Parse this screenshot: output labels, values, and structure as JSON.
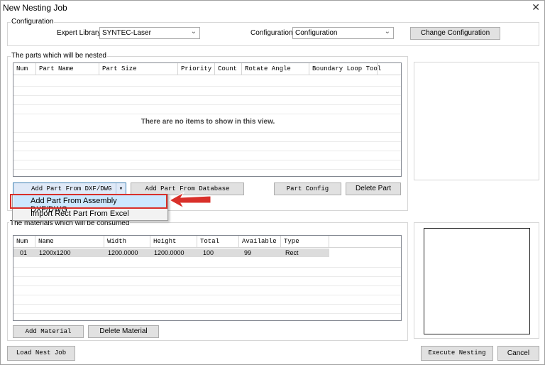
{
  "window": {
    "title": "New Nesting Job",
    "close_glyph": "✕"
  },
  "configuration": {
    "group_label": "Configuration",
    "expert_library_label": "Expert Library:",
    "expert_library_value": "SYNTEC-Laser",
    "configuration_label": "Configuration:",
    "configuration_value": "Configuration",
    "change_button": "Change Configuration"
  },
  "parts": {
    "group_label": "The parts which will be nested",
    "columns": [
      "Num",
      "Part Name",
      "Part Size",
      "Priority",
      "Count",
      "Rotate Angle",
      "Boundary Loop Tool"
    ],
    "empty_message": "There are no items to show in this view.",
    "add_dxf_button": "Add Part From DXF/DWG",
    "add_db_button": "Add Part From Database",
    "config_button": "Part Config",
    "delete_button": "Delete Part"
  },
  "dropdown": {
    "items": [
      "Add Part From Assembly DXF/DWG",
      "Import Rect Part From Excel"
    ],
    "highlight_color": "#cce8ff",
    "callout_color": "#d9302a"
  },
  "materials": {
    "group_label": "The materials which will be consumed",
    "columns": [
      "Num",
      "Name",
      "Width",
      "Height",
      "Total",
      "Available",
      "Type"
    ],
    "rows": [
      [
        "01",
        "1200x1200",
        "1200.0000",
        "1200.0000",
        "100",
        "99",
        "Rect"
      ]
    ],
    "add_button": "Add Material",
    "delete_button": "Delete Material"
  },
  "footer": {
    "load_button": "Load Nest Job",
    "execute_button": "Execute Nesting",
    "cancel_button": "Cancel"
  },
  "icons": {
    "dropdown_arrow": "chevron-down-icon",
    "close": "close-icon",
    "callout_arrow": "red-arrow-icon"
  }
}
